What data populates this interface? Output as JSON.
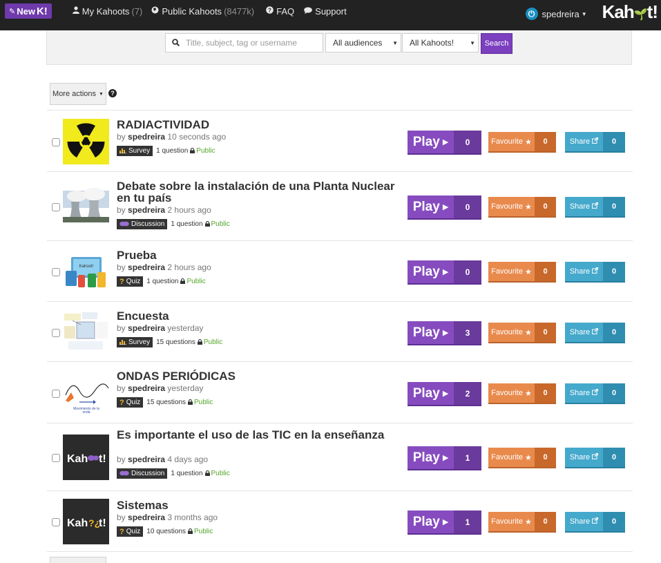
{
  "navbar": {
    "new_label": "New",
    "new_k": "K!",
    "my_kahoots_label": "My Kahoots",
    "my_kahoots_count": "(7)",
    "public_kahoots_label": "Public Kahoots",
    "public_kahoots_count": "(8477k)",
    "faq_label": "FAQ",
    "support_label": "Support",
    "username": "spedreira",
    "logo_text": "Kahoot!"
  },
  "search": {
    "placeholder": "Title, subject, tag or username",
    "audience_value": "All audiences",
    "kahoots_value": "All Kahoots!",
    "button_label": "Search"
  },
  "toolbar": {
    "more_actions_label": "More actions",
    "help_symbol": "?"
  },
  "colors": {
    "play": "#864cbf",
    "favourite": "#e98a4d",
    "share": "#45a9cc",
    "public": "#52a528",
    "navbar": "#222222"
  },
  "kahoots": [
    {
      "title": "RADIACTIVIDAD",
      "author": "spedreira",
      "time": "10 seconds ago",
      "type": "Survey",
      "type_icon": "bar-chart-icon",
      "questions": "1 question",
      "visibility": "Public",
      "plays": "0",
      "favourites": "0",
      "shares": "0",
      "play_label": "Play",
      "favourite_label": "Favourite",
      "share_label": "Share",
      "thumbnail": "radiation-symbol"
    },
    {
      "title": "Debate sobre la instalación de una Planta Nuclear en tu país",
      "author": "spedreira",
      "time": "2 hours ago",
      "type": "Discussion",
      "type_icon": "speech-bubbles-icon",
      "questions": "1 question",
      "visibility": "Public",
      "plays": "0",
      "favourites": "0",
      "shares": "0",
      "play_label": "Play",
      "favourite_label": "Favourite",
      "share_label": "Share",
      "thumbnail": "cooling-towers-photo"
    },
    {
      "title": "Prueba",
      "author": "spedreira",
      "time": "2 hours ago",
      "type": "Quiz",
      "type_icon": "question-mark-icon",
      "questions": "1 question",
      "visibility": "Public",
      "plays": "0",
      "favourites": "0",
      "shares": "0",
      "play_label": "Play",
      "favourite_label": "Favourite",
      "share_label": "Share",
      "thumbnail": "devices-illustration"
    },
    {
      "title": "Encuesta",
      "author": "spedreira",
      "time": "yesterday",
      "type": "Survey",
      "type_icon": "bar-chart-icon",
      "questions": "15 questions",
      "visibility": "Public",
      "plays": "3",
      "favourites": "0",
      "shares": "0",
      "play_label": "Play",
      "favourite_label": "Favourite",
      "share_label": "Share",
      "thumbnail": "diagram-illustration"
    },
    {
      "title": "ONDAS PERIÓDICAS",
      "author": "spedreira",
      "time": "yesterday",
      "type": "Quiz",
      "type_icon": "question-mark-icon",
      "questions": "15 questions",
      "visibility": "Public",
      "plays": "2",
      "favourites": "0",
      "shares": "0",
      "play_label": "Play",
      "favourite_label": "Favourite",
      "share_label": "Share",
      "thumbnail": "wave-illustration"
    },
    {
      "title": "Es importante el uso de las TIC en la enseñanza",
      "author": "spedreira",
      "time": "4 days ago",
      "type": "Discussion",
      "type_icon": "speech-bubbles-icon",
      "questions": "1 question",
      "visibility": "Public",
      "plays": "1",
      "favourites": "0",
      "shares": "0",
      "play_label": "Play",
      "favourite_label": "Favourite",
      "share_label": "Share",
      "thumbnail": "kahoot-logo-discussion"
    },
    {
      "title": "Sistemas",
      "author": "spedreira",
      "time": "3 months ago",
      "type": "Quiz",
      "type_icon": "question-mark-icon",
      "questions": "10 questions",
      "visibility": "Public",
      "plays": "1",
      "favourites": "0",
      "shares": "0",
      "play_label": "Play",
      "favourite_label": "Favourite",
      "share_label": "Share",
      "thumbnail": "kahoot-logo-quiz"
    }
  ]
}
